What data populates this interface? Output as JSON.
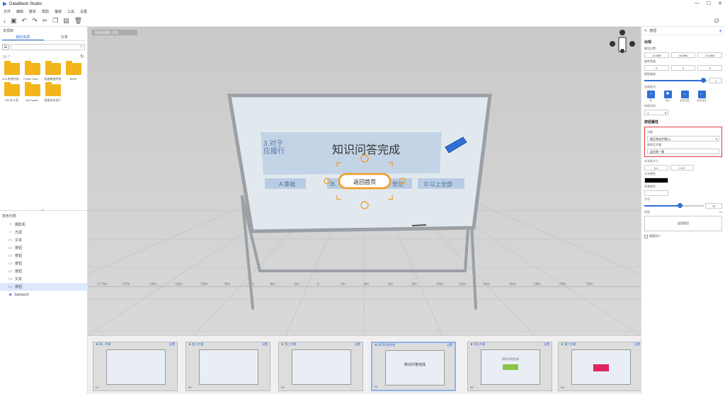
{
  "app": {
    "title": "DataMesh Studio"
  },
  "menu": [
    "文件",
    "编辑",
    "脚本",
    "帮助",
    "播放",
    "工具",
    "设置"
  ],
  "window_controls": [
    "—",
    "☐",
    "✕"
  ],
  "left_panel": {
    "title": "资源库",
    "tabs": [
      "我的资源",
      "分享"
    ],
    "active_tab": 0,
    "path": "/",
    "folders": [
      "HOL发表传统…",
      "Public Shar…",
      "机器数据传统",
      "BIMS",
      "DM 办公室",
      "My Space",
      "智能测试部门"
    ]
  },
  "roles": {
    "title": "角色列表",
    "items": [
      {
        "icon": "camera-icon",
        "label": "摄影机"
      },
      {
        "icon": "light-icon",
        "label": "光源"
      },
      {
        "icon": "text-icon",
        "label": "文本"
      },
      {
        "icon": "button-icon",
        "label": "按钮"
      },
      {
        "icon": "button-icon",
        "label": "按钮"
      },
      {
        "icon": "button-icon",
        "label": "按钮"
      },
      {
        "icon": "button-icon",
        "label": "按钮"
      },
      {
        "icon": "text-icon",
        "label": "文本"
      },
      {
        "icon": "button-icon",
        "label": "按钮",
        "selected": true
      },
      {
        "icon": "model-icon",
        "label": "barbarz2"
      }
    ]
  },
  "viewport": {
    "tag": "知识问题1 (02)",
    "board_title": "知识问答完成",
    "board_question": "3.对于\n应履行",
    "options": [
      "A.审批",
      "B.",
      "D.以上全部"
    ],
    "option_frag": "登记",
    "return_button": "返回首页",
    "ruler_labels": [
      "-17.5m",
      "-17m",
      "-16m",
      "-12m",
      "-10m",
      "-8m",
      "-6m",
      "-4m",
      "-2m",
      "0",
      "2m",
      "4m",
      "6m",
      "8m",
      "10m",
      "12m",
      "14m",
      "16m",
      "18m",
      "20m",
      "22m"
    ]
  },
  "timeline": [
    {
      "num": "01",
      "label": "第一步骤",
      "cfg": "设置",
      "active": false
    },
    {
      "num": "02",
      "label": "第二步骤",
      "cfg": "设置",
      "active": false
    },
    {
      "num": "03",
      "label": "第三步骤",
      "cfg": "设置",
      "active": false
    },
    {
      "num": "04",
      "label": "知识问答完成",
      "cfg": "设置",
      "active": true
    },
    {
      "num": "05",
      "label": "第五步骤",
      "cfg": "设置",
      "active": false
    },
    {
      "num": "06",
      "label": "第六步骤",
      "cfg": "设置",
      "active": false
    }
  ],
  "thumb_texts": {
    "t4": "知识问答完成",
    "t5": "知识问答完成"
  },
  "right_panel": {
    "header": "按钮",
    "section_appear": "出现",
    "pos_label": "模型位置",
    "pos": [
      "-0.0387",
      "10.884",
      "-9.2453"
    ],
    "rot_label": "旋转角度",
    "rot": [
      "0",
      "0",
      "0"
    ],
    "scale_label": "模型缩放",
    "scale_val": "1",
    "scale_frac": 0.92,
    "anim_label": "出现样式",
    "modes": [
      {
        "icon": "○",
        "label": "无"
      },
      {
        "icon": "✺",
        "label": "淡入"
      },
      {
        "icon": "→",
        "label": "从左往右"
      },
      {
        "icon": "←",
        "label": "从右往左"
      }
    ],
    "duration_label": "持续时间",
    "duration": "1",
    "section_btn": "按钮属性",
    "event_label": "功能",
    "event_value": "跳至其他步骤(1)",
    "target_label": "跳转至步骤",
    "target_value": "返回第一幕",
    "text_size_label": "文本框大小",
    "text_size": [
      "0.4",
      "0.12"
    ],
    "text_color_label": "文字颜色",
    "text_color": "#000000",
    "bg_color_label": "背景颜色",
    "bg_color": "#ffffff",
    "font_size_label": "字号",
    "font_size": "75",
    "font_frac": 0.6,
    "content_label": "内容",
    "content_value": "返回首页",
    "checkbox_label": "跟随用户"
  },
  "colors": {
    "accent": "#2f6fd6",
    "highlight": "#e03a3a",
    "folder": "#f2b51b"
  }
}
